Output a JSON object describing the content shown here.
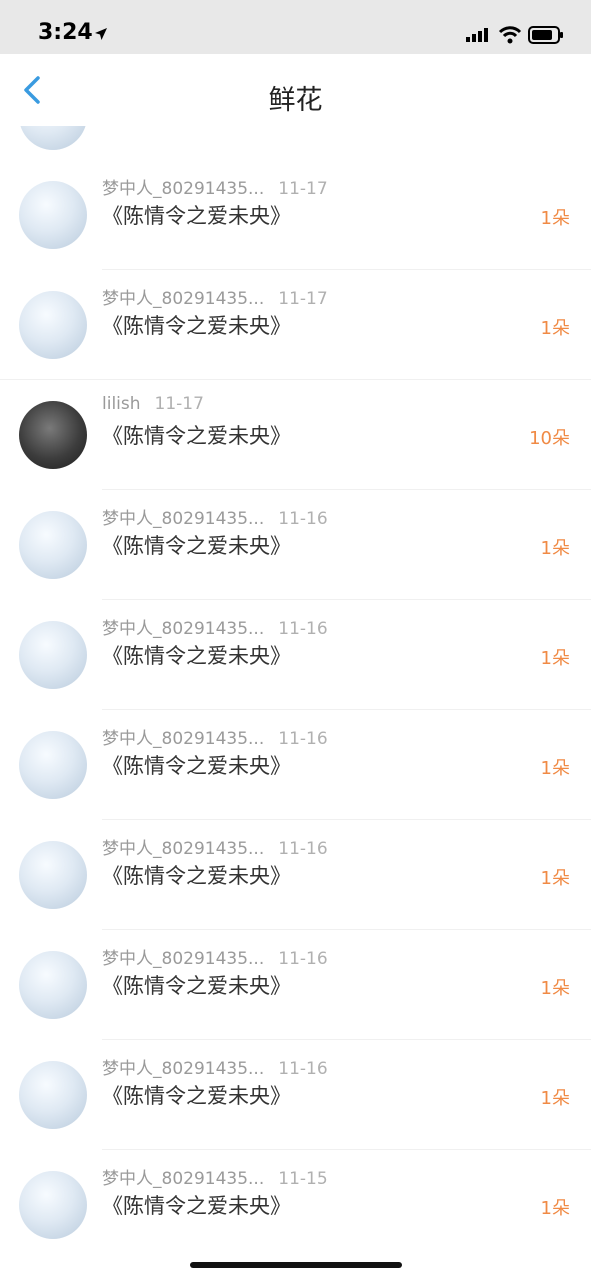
{
  "status_bar": {
    "time": "3:24"
  },
  "header": {
    "title": "鲜花"
  },
  "items": [
    {
      "user": "梦中人_80291435...",
      "date": "11-17",
      "book": "《陈情令之爱未央》",
      "count": "1朵",
      "avatar": "flower"
    },
    {
      "user": "梦中人_80291435...",
      "date": "11-17",
      "book": "《陈情令之爱未央》",
      "count": "1朵",
      "avatar": "flower"
    },
    {
      "user": "lilish",
      "date": "11-17",
      "book": "《陈情令之爱未央》",
      "count": "10朵",
      "avatar": "dark"
    },
    {
      "user": "梦中人_80291435...",
      "date": "11-16",
      "book": "《陈情令之爱未央》",
      "count": "1朵",
      "avatar": "flower"
    },
    {
      "user": "梦中人_80291435...",
      "date": "11-16",
      "book": "《陈情令之爱未央》",
      "count": "1朵",
      "avatar": "flower"
    },
    {
      "user": "梦中人_80291435...",
      "date": "11-16",
      "book": "《陈情令之爱未央》",
      "count": "1朵",
      "avatar": "flower"
    },
    {
      "user": "梦中人_80291435...",
      "date": "11-16",
      "book": "《陈情令之爱未央》",
      "count": "1朵",
      "avatar": "flower"
    },
    {
      "user": "梦中人_80291435...",
      "date": "11-16",
      "book": "《陈情令之爱未央》",
      "count": "1朵",
      "avatar": "flower"
    },
    {
      "user": "梦中人_80291435...",
      "date": "11-16",
      "book": "《陈情令之爱未央》",
      "count": "1朵",
      "avatar": "flower"
    },
    {
      "user": "梦中人_80291435...",
      "date": "11-15",
      "book": "《陈情令之爱未央》",
      "count": "1朵",
      "avatar": "flower"
    }
  ],
  "colors": {
    "count": "#f08a45",
    "back_arrow": "#3a9be0"
  }
}
